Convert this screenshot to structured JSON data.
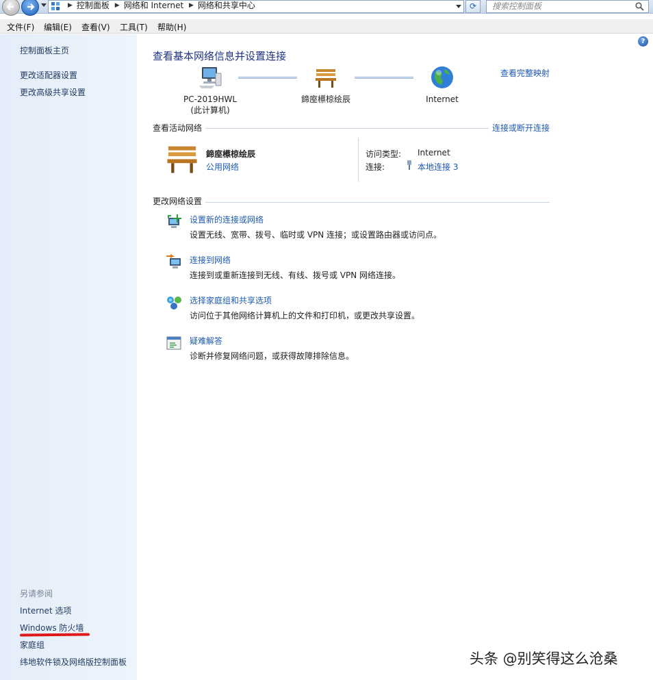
{
  "address_bar": {
    "crumbs": [
      "控制面板",
      "网络和 Internet",
      "网络和共享中心"
    ],
    "search_placeholder": "搜索控制面板"
  },
  "menu": [
    "文件(F)",
    "编辑(E)",
    "查看(V)",
    "工具(T)",
    "帮助(H)"
  ],
  "sidebar": {
    "links": [
      "控制面板主页",
      "更改适配器设置",
      "更改高级共享设置"
    ],
    "see_also_title": "另请参阅",
    "see_also": [
      "Internet 选项",
      "Windows 防火墙",
      "家庭组",
      "纬地软件锁及网络版控制面板"
    ]
  },
  "main": {
    "title": "查看基本网络信息并设置连接",
    "view_full_map": "查看完整映射",
    "nodes": [
      {
        "label": "PC-2019HWL",
        "sub": "(此计算机)"
      },
      {
        "label": "鍗庢櫒椋绘辰",
        "sub": ""
      },
      {
        "label": "Internet",
        "sub": ""
      }
    ],
    "active_networks": {
      "heading": "查看活动网络",
      "action": "连接或断开连接",
      "network_name": "鍗庢櫒椋绘辰",
      "network_type": "公用网络",
      "access_type_label": "访问类型:",
      "access_type_value": "Internet",
      "connections_label": "连接:",
      "connections_value": "本地连接 3"
    },
    "change_settings": {
      "heading": "更改网络设置",
      "tasks": [
        {
          "icon": "network-setup-icon",
          "title": "设置新的连接或网络",
          "desc": "设置无线、宽带、拨号、临时或 VPN 连接；或设置路由器或访问点。"
        },
        {
          "icon": "connect-network-icon",
          "title": "连接到网络",
          "desc": "连接到或重新连接到无线、有线、拨号或 VPN 网络连接。"
        },
        {
          "icon": "homegroup-icon",
          "title": "选择家庭组和共享选项",
          "desc": "访问位于其他网络计算机上的文件和打印机，或更改共享设置。"
        },
        {
          "icon": "troubleshoot-icon",
          "title": "疑难解答",
          "desc": "诊断并修复网络问题，或获得故障排除信息。"
        }
      ]
    }
  },
  "watermark": "头条 @别笑得这么沧桑",
  "colors": {
    "link": "#1e5ab4",
    "title": "#1e3287",
    "sidebar_bg": "#e4edf9",
    "annotation": "#e11818"
  }
}
